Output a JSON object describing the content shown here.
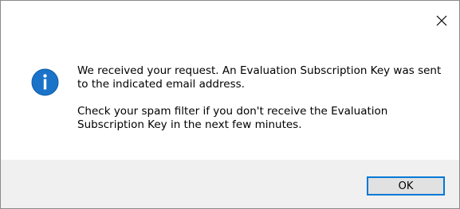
{
  "dialog": {
    "close_glyph": "✕",
    "icon": "information-icon",
    "message": {
      "paragraph1": "We received your request. An Evaluation Subscription Key was sent to the indicated email address.",
      "paragraph2": "Check your spam filter if you don't receive the Evaluation Subscription Key in the next few minutes."
    },
    "ok_label": "OK",
    "colors": {
      "icon_fill": "#1a73c8",
      "button_border": "#0078d7",
      "footer_bg": "#f0f0f0"
    }
  }
}
